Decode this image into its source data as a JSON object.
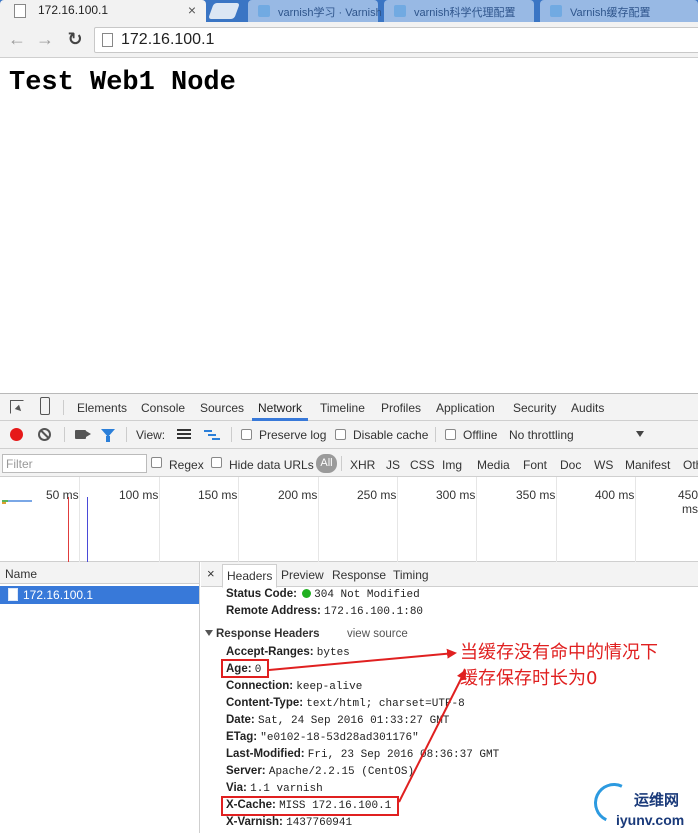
{
  "browser": {
    "active_tab_title": "172.16.100.1",
    "background_tabs": [
      "varnish学习 · Varnish",
      "varnish科学代理配置",
      "Varnish缓存配置"
    ],
    "url": "172.16.100.1"
  },
  "page": {
    "heading": "Test Web1 Node"
  },
  "devtools": {
    "tabs": [
      "Elements",
      "Console",
      "Sources",
      "Network",
      "Timeline",
      "Profiles",
      "Application",
      "Security",
      "Audits"
    ],
    "active_tab": "Network",
    "network_toolbar": {
      "view_label": "View:",
      "preserve_log": "Preserve log",
      "disable_cache": "Disable cache",
      "offline": "Offline",
      "throttling": "No throttling"
    },
    "filter_bar": {
      "placeholder": "Filter",
      "regex": "Regex",
      "hide_data_urls": "Hide data URLs",
      "all": "All",
      "types": [
        "XHR",
        "JS",
        "CSS",
        "Img",
        "Media",
        "Font",
        "Doc",
        "WS",
        "Manifest",
        "Oth"
      ]
    },
    "timeline_labels": [
      "50 ms",
      "100 ms",
      "150 ms",
      "200 ms",
      "250 ms",
      "300 ms",
      "350 ms",
      "400 ms",
      "450 ms"
    ],
    "name_column_header": "Name",
    "requests": [
      {
        "name": "172.16.100.1",
        "selected": true
      }
    ],
    "detail_tabs": [
      "Headers",
      "Preview",
      "Response",
      "Timing"
    ],
    "active_detail_tab": "Headers",
    "general": [
      {
        "key": "Status Code:",
        "value": "304 Not Modified",
        "status_dot": true
      },
      {
        "key": "Remote Address:",
        "value": "172.16.100.1:80"
      }
    ],
    "response_headers_title": "Response Headers",
    "view_source": "view source",
    "response_headers": [
      {
        "key": "Accept-Ranges:",
        "value": "bytes"
      },
      {
        "key": "Age:",
        "value": "0",
        "highlight": true
      },
      {
        "key": "Connection:",
        "value": "keep-alive"
      },
      {
        "key": "Content-Type:",
        "value": "text/html; charset=UTF-8"
      },
      {
        "key": "Date:",
        "value": "Sat, 24 Sep 2016 01:33:27 GMT"
      },
      {
        "key": "ETag:",
        "value": "\"e0102-18-53d28ad301176\""
      },
      {
        "key": "Last-Modified:",
        "value": "Fri, 23 Sep 2016 08:36:37 GMT"
      },
      {
        "key": "Server:",
        "value": "Apache/2.2.15 (CentOS)"
      },
      {
        "key": "Via:",
        "value": "1.1 varnish"
      },
      {
        "key": "X-Cache:",
        "value": "MISS 172.16.100.1",
        "highlight": true
      },
      {
        "key": "X-Varnish:",
        "value": "1437760941"
      }
    ]
  },
  "annotation": {
    "line1": "当缓存没有命中的情况下",
    "line2": "缓存保存时长为0",
    "color": "#e02020"
  },
  "watermark": {
    "brand_cn": "运维网",
    "domain": "iyunv.com"
  },
  "colors": {
    "accent": "#3879d9",
    "record": "#e61919",
    "status_ok": "#20b020",
    "tabstrip": "#3a75c4"
  }
}
